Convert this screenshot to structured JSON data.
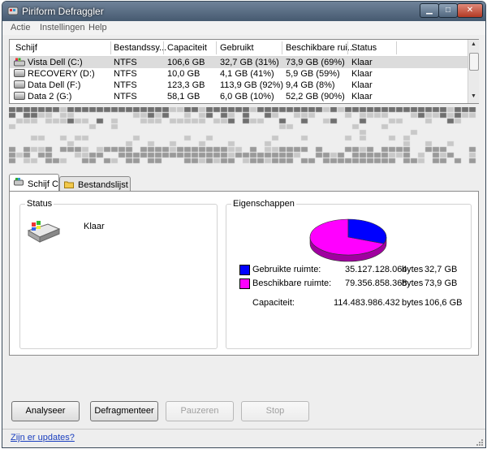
{
  "window": {
    "title": "Piriform Defraggler",
    "min_glyph": "▁",
    "max_glyph": "□",
    "close_glyph": "✕"
  },
  "menu": [
    "Actie",
    "Instellingen",
    "Help"
  ],
  "drive_list": {
    "columns": [
      "Schijf",
      "Bestandssy...",
      "Capaciteit",
      "Gebruikt",
      "Beschikbare rui...",
      "Status"
    ],
    "rows": [
      [
        "Vista Dell (C:)",
        "NTFS",
        "106,6 GB",
        "32,7 GB (31%)",
        "73,9 GB (69%)",
        "Klaar"
      ],
      [
        "RECOVERY (D:)",
        "NTFS",
        "10,0 GB",
        "4,1 GB (41%)",
        "5,9 GB (59%)",
        "Klaar"
      ],
      [
        "Data Dell (F:)",
        "NTFS",
        "123,3 GB",
        "113,9 GB (92%)",
        "9,4 GB (8%)",
        "Klaar"
      ],
      [
        "Data 2 (G:)",
        "NTFS",
        "58,1 GB",
        "6,0 GB (10%)",
        "52,2 GB (90%)",
        "Klaar"
      ]
    ],
    "selected_index": 0
  },
  "tabs": [
    {
      "label": "Schijf C:",
      "icon": "drive-icon",
      "active": true
    },
    {
      "label": "Bestandslijst",
      "icon": "folder-icon",
      "active": false
    }
  ],
  "status_group": {
    "title": "Status",
    "text": "Klaar",
    "icon": "drive-icon"
  },
  "properties_group": {
    "title": "Eigenschappen",
    "used": {
      "label": "Gebruikte ruimte:",
      "bytes": "35.127.128.064",
      "unit": "bytes",
      "gb": "32,7 GB",
      "color": "#0000ff"
    },
    "free": {
      "label": "Beschikbare ruimte:",
      "bytes": "79.356.858.368",
      "unit": "bytes",
      "gb": "73,9 GB",
      "color": "#ff00ff"
    },
    "capacity": {
      "label": "Capaciteit:",
      "bytes": "114.483.986.432",
      "unit": "bytes",
      "gb": "106,6 GB"
    },
    "pie": {
      "used_fraction": 0.31,
      "free_fraction": 0.69
    }
  },
  "buttons": {
    "analyze": "Analyseer",
    "defrag": "Defragmenteer",
    "pause": "Pauzeren",
    "stop": "Stop"
  },
  "statusbar": {
    "link": "Zijn er updates?"
  }
}
